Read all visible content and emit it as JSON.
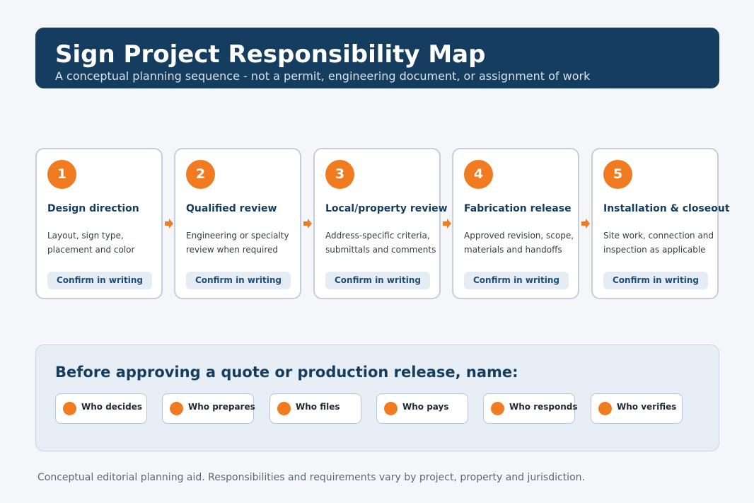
{
  "header": {
    "title": "Sign Project Responsibility Map",
    "subtitle": "A conceptual planning sequence - not a permit, engineering document, or assignment of work"
  },
  "steps": [
    {
      "number": "1",
      "title": "Design direction",
      "desc_line1": "Layout, sign type,",
      "desc_line2": "placement and color",
      "badge": "Confirm in writing"
    },
    {
      "number": "2",
      "title": "Qualified review",
      "desc_line1": "Engineering or specialty",
      "desc_line2": "review when required",
      "badge": "Confirm in writing"
    },
    {
      "number": "3",
      "title": "Local/property review",
      "desc_line1": "Address-specific criteria,",
      "desc_line2": "submittals and comments",
      "badge": "Confirm in writing"
    },
    {
      "number": "4",
      "title": "Fabrication release",
      "desc_line1": "Approved revision, scope,",
      "desc_line2": "materials and handoffs",
      "badge": "Confirm in writing"
    },
    {
      "number": "5",
      "title": "Installation & closeout",
      "desc_line1": "Site work, connection and",
      "desc_line2": "inspection as applicable",
      "badge": "Confirm in writing"
    }
  ],
  "names_panel": {
    "heading": "Before approving a quote or production release, name:",
    "chips": [
      "Who decides",
      "Who prepares",
      "Who files",
      "Who pays",
      "Who responds",
      "Who verifies"
    ]
  },
  "footer": {
    "note": "Conceptual editorial planning aid. Responsibilities and requirements vary by project, property and jurisdiction."
  },
  "colors": {
    "banner": "#143d5f",
    "accent": "#f07b20",
    "card_border": "#c3cfdc",
    "panel": "#e7eef5"
  }
}
